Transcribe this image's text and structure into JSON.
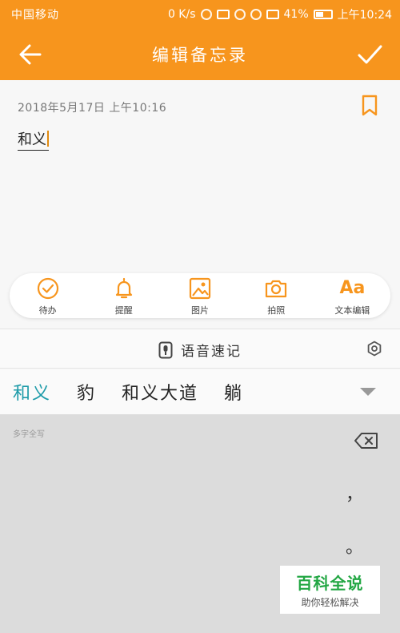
{
  "status_bar": {
    "carrier": "中国移动",
    "speed": "0 K/s",
    "battery": "41%",
    "time": "上午10:24"
  },
  "header": {
    "title": "编辑备忘录",
    "back_icon": "arrow-left-icon",
    "confirm_icon": "checkmark-icon"
  },
  "note": {
    "date": "2018年5月17日  上午10:16",
    "text": "和义"
  },
  "toolbar": {
    "items": [
      {
        "label": "待办",
        "icon": "check-circle-icon"
      },
      {
        "label": "提醒",
        "icon": "bell-icon"
      },
      {
        "label": "图片",
        "icon": "image-icon"
      },
      {
        "label": "拍照",
        "icon": "camera-icon"
      },
      {
        "label": "文本编辑",
        "icon_text": "Aa"
      }
    ]
  },
  "voice": {
    "label": "语音速记"
  },
  "candidates": {
    "items": [
      "和义",
      "豹",
      "和义大道",
      "躺"
    ]
  },
  "keyboard": {
    "hint": "多字全写",
    "punct": [
      "，",
      "。"
    ]
  },
  "watermark": {
    "title": "百科全说",
    "subtitle": "助你轻松解决"
  },
  "colors": {
    "accent": "#f7951d",
    "candidate_active": "#1b9aa8",
    "watermark_green": "#23a744"
  }
}
